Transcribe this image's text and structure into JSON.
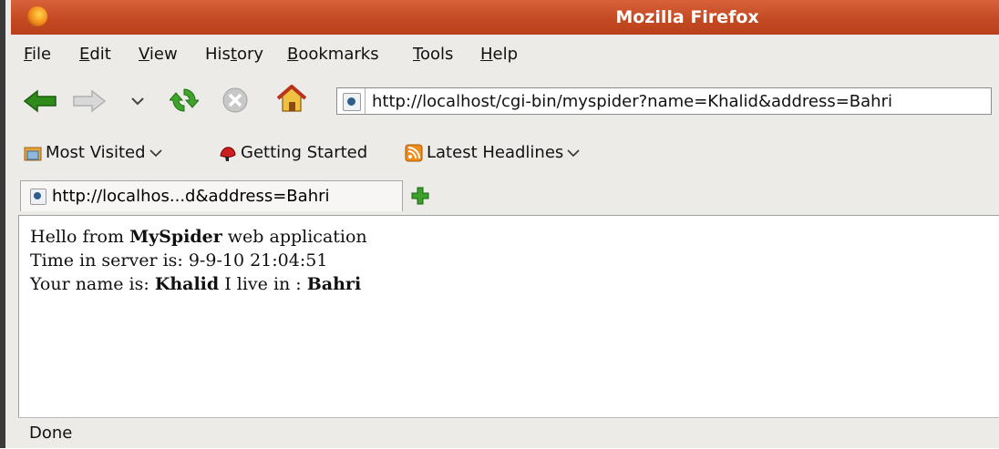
{
  "window": {
    "title": "Mozilla Firefox"
  },
  "menu": {
    "file": {
      "pre": "",
      "key": "F",
      "post": "ile"
    },
    "edit": {
      "pre": "",
      "key": "E",
      "post": "dit"
    },
    "view": {
      "pre": "",
      "key": "V",
      "post": "iew"
    },
    "history": {
      "pre": "His",
      "key": "t",
      "post": "ory"
    },
    "bookmarks": {
      "pre": "",
      "key": "B",
      "post": "ookmarks"
    },
    "tools": {
      "pre": "",
      "key": "T",
      "post": "ools"
    },
    "help": {
      "pre": "",
      "key": "H",
      "post": "elp"
    }
  },
  "navigation": {
    "url": "http://localhost/cgi-bin/myspider?name=Khalid&address=Bahri"
  },
  "bookmarks": {
    "most_visited": "Most Visited",
    "getting_started": "Getting Started",
    "latest_headlines": "Latest Headlines"
  },
  "tab": {
    "label": "http://localhos...d&address=Bahri"
  },
  "page": {
    "line1": {
      "pre": "Hello from ",
      "bold": "MySpider",
      "post": " web application"
    },
    "line2": "Time in server is: 9-9-10 21:04:51",
    "line3": {
      "pre": "Your name is: ",
      "name": "Khalid",
      "mid": " I live in : ",
      "place": "Bahri"
    }
  },
  "status": "Done",
  "colors": {
    "titlebar": "#c44a22",
    "back_arrow": "#2e8b1a",
    "stop": "#b8b8b8"
  }
}
